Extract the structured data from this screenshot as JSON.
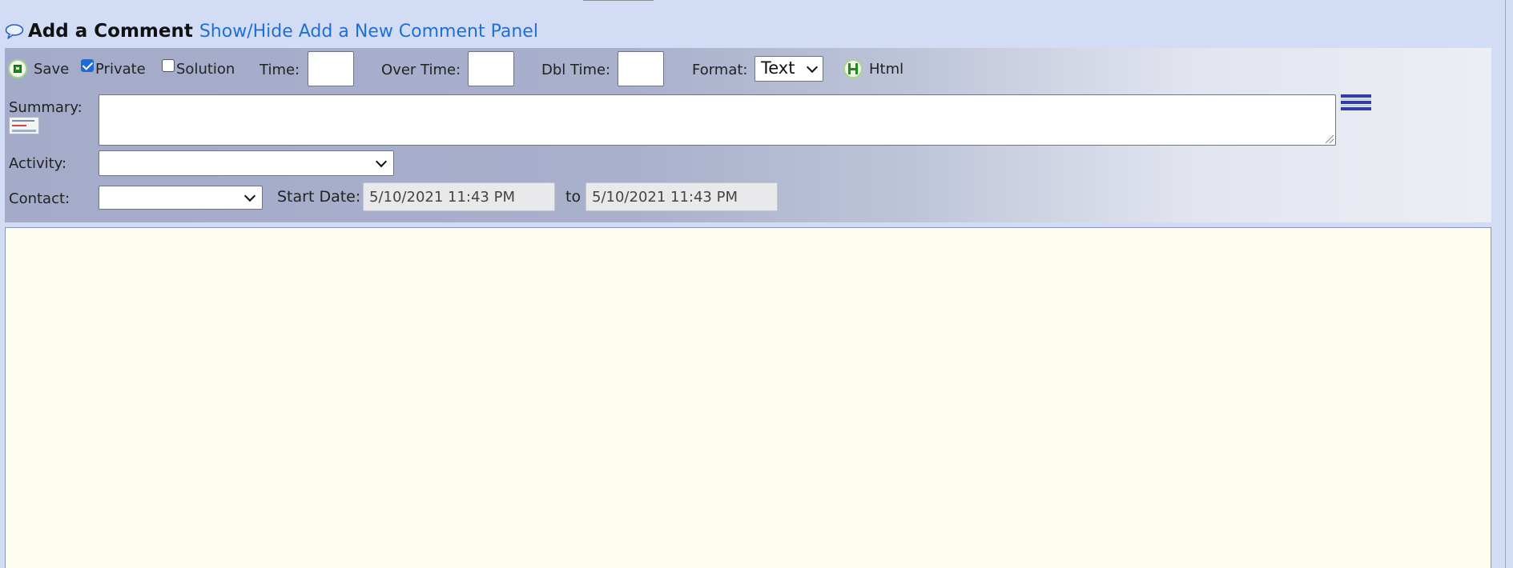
{
  "header": {
    "title": "Add a Comment",
    "toggle_link": "Show/Hide Add a New Comment Panel"
  },
  "toolbar": {
    "save_label": "Save",
    "private_label": "Private",
    "private_checked": true,
    "solution_label": "Solution",
    "solution_checked": false,
    "time_label": "Time:",
    "overtime_label": "Over Time:",
    "dbltime_label": "Dbl Time:",
    "format_label": "Format:",
    "format_value": "Text",
    "html_label": "Html"
  },
  "form": {
    "summary_label": "Summary:",
    "activity_label": "Activity:",
    "contact_label": "Contact:",
    "start_date_label": "Start Date:",
    "start_date_value": "5/10/2021 11:43 PM",
    "to_label": "to",
    "end_date_value": "5/10/2021 11:43 PM"
  },
  "icons": {
    "header": "comment-bubble-icon",
    "save": "save-icon",
    "html": "html-h-icon",
    "table": "table-icon"
  },
  "colors": {
    "page_bg": "#d2dcf5",
    "link": "#1e70d6",
    "editor_bg": "#fefeee",
    "checkbox_checked": "#1e6bd6"
  }
}
